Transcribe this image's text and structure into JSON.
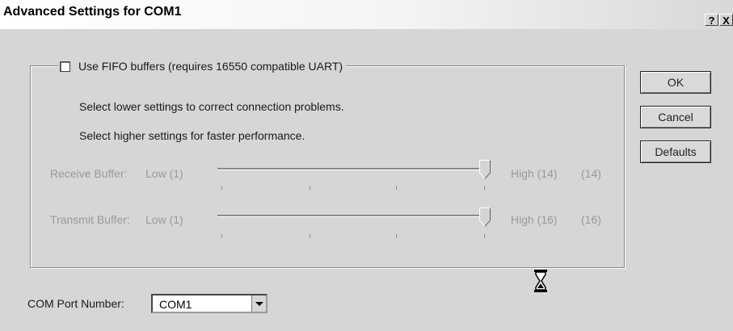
{
  "window": {
    "title": "Advanced Settings for COM1",
    "help_button": "?",
    "close_button": "X"
  },
  "fifo": {
    "checkbox_label": "Use FIFO buffers (requires 16550 compatible UART)",
    "checked": false
  },
  "hints": {
    "lower": "Select lower settings to correct connection problems.",
    "higher": "Select higher settings for faster performance."
  },
  "receive_buffer": {
    "label": "Receive Buffer:",
    "low_label": "Low (1)",
    "high_label": "High (14)",
    "value_display": "(14)",
    "value": 14
  },
  "transmit_buffer": {
    "label": "Transmit Buffer:",
    "low_label": "Low (1)",
    "high_label": "High (16)",
    "value_display": "(16)",
    "value": 16
  },
  "buttons": {
    "ok": "OK",
    "cancel": "Cancel",
    "defaults": "Defaults"
  },
  "com_port": {
    "label": "COM Port Number:",
    "selected": "COM1"
  },
  "icons": {
    "cursor": "hourglass-icon",
    "dropdown": "chevron-down-icon"
  },
  "colors": {
    "dialog_bg": "#d6d6d6",
    "disabled_text": "#9a9a9a"
  }
}
